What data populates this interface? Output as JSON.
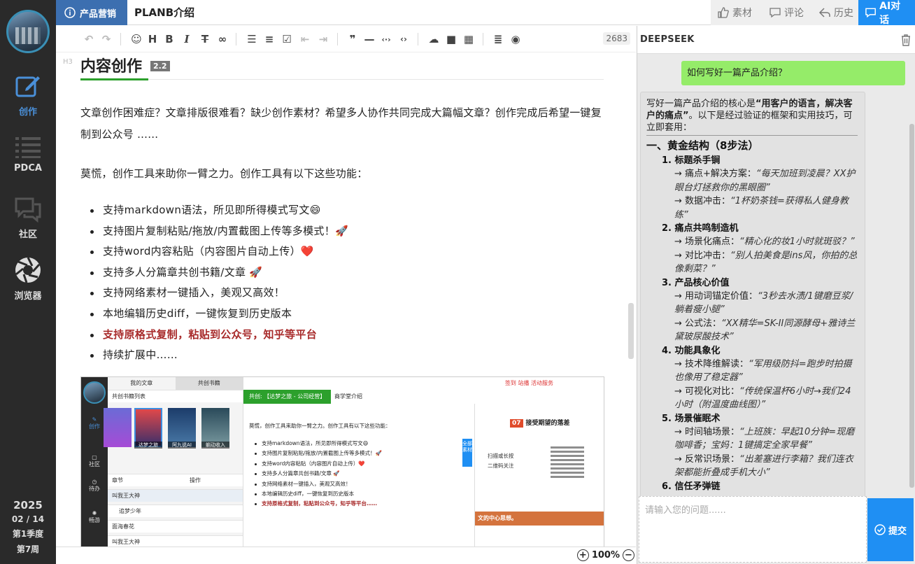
{
  "sidebar": {
    "items": [
      {
        "label": "创作",
        "icon": "edit-icon",
        "active": true
      },
      {
        "label": "PDCA",
        "icon": "list-icon",
        "active": false
      },
      {
        "label": "社区",
        "icon": "chat-icon",
        "active": false
      },
      {
        "label": "浏览器",
        "icon": "aperture-icon",
        "active": false
      }
    ],
    "footer": {
      "year": "2025",
      "date": "02 / 14",
      "quarter": "第1季度",
      "week": "第7周"
    }
  },
  "topbar": {
    "category": "产品营销",
    "doc_title": "PLANB介绍",
    "buttons": {
      "material": "素材",
      "comment": "评论",
      "history": "历史",
      "ai_chat": "AI对话"
    }
  },
  "toolbar": {
    "word_count": "2683"
  },
  "editor": {
    "heading_mark": "H3",
    "heading": "内容创作",
    "version": "2.2",
    "para1": "文章创作困难症？文章排版很难看？缺少创作素材？希望多人协作共同完成大篇幅文章？创作完成后希望一键复制到公众号 ……",
    "para2": "莫慌，创作工具来助你一臂之力。创作工具有以下这些功能：",
    "features": [
      {
        "text": "支持markdown语法，所见即所得模式写文😄",
        "red": false
      },
      {
        "text": "支持图片复制粘贴/拖放/内置截图上传等多模式！🚀",
        "red": false
      },
      {
        "text": "支持word内容粘贴（内容图片自动上传）❤️",
        "red": false
      },
      {
        "text": "支持多人分篇章共创书籍/文章 🚀",
        "red": false
      },
      {
        "text": "支持网络素材一键插入，美观又高效！",
        "red": false
      },
      {
        "text": "本地编辑历史diff，一键恢复到历史版本",
        "red": false
      },
      {
        "text": "支持原格式复制，粘贴到公众号，知乎等平台",
        "red": true
      },
      {
        "text": "持续扩展中……",
        "red": false
      }
    ],
    "screenshot": {
      "tabs": [
        "我的文章",
        "共创书籍"
      ],
      "list_title": "共创书籍列表",
      "covers": [
        "",
        "追梦少年",
        "达梦之旅",
        "阿九说AI",
        "躺动收入"
      ],
      "side_items": [
        "创作",
        "社区",
        "待办",
        "畅游"
      ],
      "chapter_header": "章节",
      "op_header": "操作",
      "chapters": [
        "叫我王大神",
        "追梦少年",
        "面海春花",
        "叫我王大神"
      ],
      "tag": "共创: 【达梦之旅 - 公司经营】",
      "doc": "商学堂介绍",
      "top_links": [
        "签到",
        "站播",
        "活动服务"
      ],
      "intro": "莫慌，创作工具来助你一臂之力。创作工具有以下这些功能：",
      "items": [
        "支持markdown语法，所见即所得模式写文😄",
        "支持图片复制粘贴/拖放/内置截图上传等多模式！🚀",
        "支持word内容粘贴（内容图片自动上传）❤️",
        "支持多人分篇章共创书籍/文章 🚀",
        "支持网络素材一键插入，美观又高效！",
        "本地编辑历史diff，一键恢复到历史版本",
        "支持原格式复制，粘贴到公众号，知乎等平台……"
      ],
      "panel_num": "07",
      "panel_title": "接受期望的落差",
      "scan_line1": "扫描或长按",
      "scan_line2": "二维码关注",
      "banner": "文的中心思想。",
      "blue_tab": "全部素材",
      "right_buttons": [
        "参数",
        "素材",
        "评论",
        "历史"
      ],
      "tooltip": "截图上传 <Ctrl+Shift+...>",
      "side_tab": "我的素材"
    }
  },
  "zoom": "100%",
  "ai": {
    "title": "DEEPSEEK",
    "user_message": "如何写好一篇产品介绍？",
    "intro_a": "写好一篇产品介绍的核心是",
    "intro_b": "“用客户的语言，解决客户的痛点”",
    "intro_c": "。以下是经过验证的框架和实用技巧，可立即套用：",
    "h1": "一、黄金结构（8步法）",
    "sections": [
      {
        "title": "1. 标题杀手锏",
        "lines": [
          {
            "label": "→ 痛点+解决方案：",
            "quote": "“每天加班到凌晨？XX护眼台灯拯救你的黑眼圈”"
          },
          {
            "label": "→ 数据冲击：",
            "quote": "“1杯奶茶钱=获得私人健身教练”"
          }
        ]
      },
      {
        "title": "2. 痛点共鸣制造机",
        "lines": [
          {
            "label": "→ 场景化痛点：",
            "quote": "“精心化的妆1小时就斑驳？”"
          },
          {
            "label": "→ 对比冲击：",
            "quote": "“别人拍美食是ins风，你拍的总像剩菜？”"
          }
        ]
      },
      {
        "title": "3. 产品核心价值",
        "lines": [
          {
            "label": "→ 用动词锚定价值：",
            "quote": "“3秒去水渍/1键磨豆浆/躺着瘦小腿”"
          },
          {
            "label": "→ 公式法：",
            "quote": "“XX精华=SK-II同源酵母+雅诗兰黛玻尿酸技术”"
          }
        ]
      },
      {
        "title": "4. 功能具象化",
        "lines": [
          {
            "label": "→ 技术降维解读：",
            "quote": "“军用级防抖=跑步时拍摄也像用了稳定器”"
          },
          {
            "label": "→ 可视化对比：",
            "quote": "“传统保温杯6小时→我们24小时（附温度曲线图）”"
          }
        ]
      },
      {
        "title": "5. 场景催眠术",
        "lines": [
          {
            "label": "→ 时间轴场景：",
            "quote": "“上班族：早起10分钟=现磨咖啡香；宝妈：1键搞定全家早餐”"
          },
          {
            "label": "→ 反常识场景：",
            "quote": "“出差塞进行李箱？我们连衣架都能折叠成手机大小”"
          }
        ]
      },
      {
        "title": "6. 信任矛弹链",
        "lines": []
      }
    ],
    "input_placeholder": "请输入您的问题......",
    "submit_label": "提交"
  }
}
